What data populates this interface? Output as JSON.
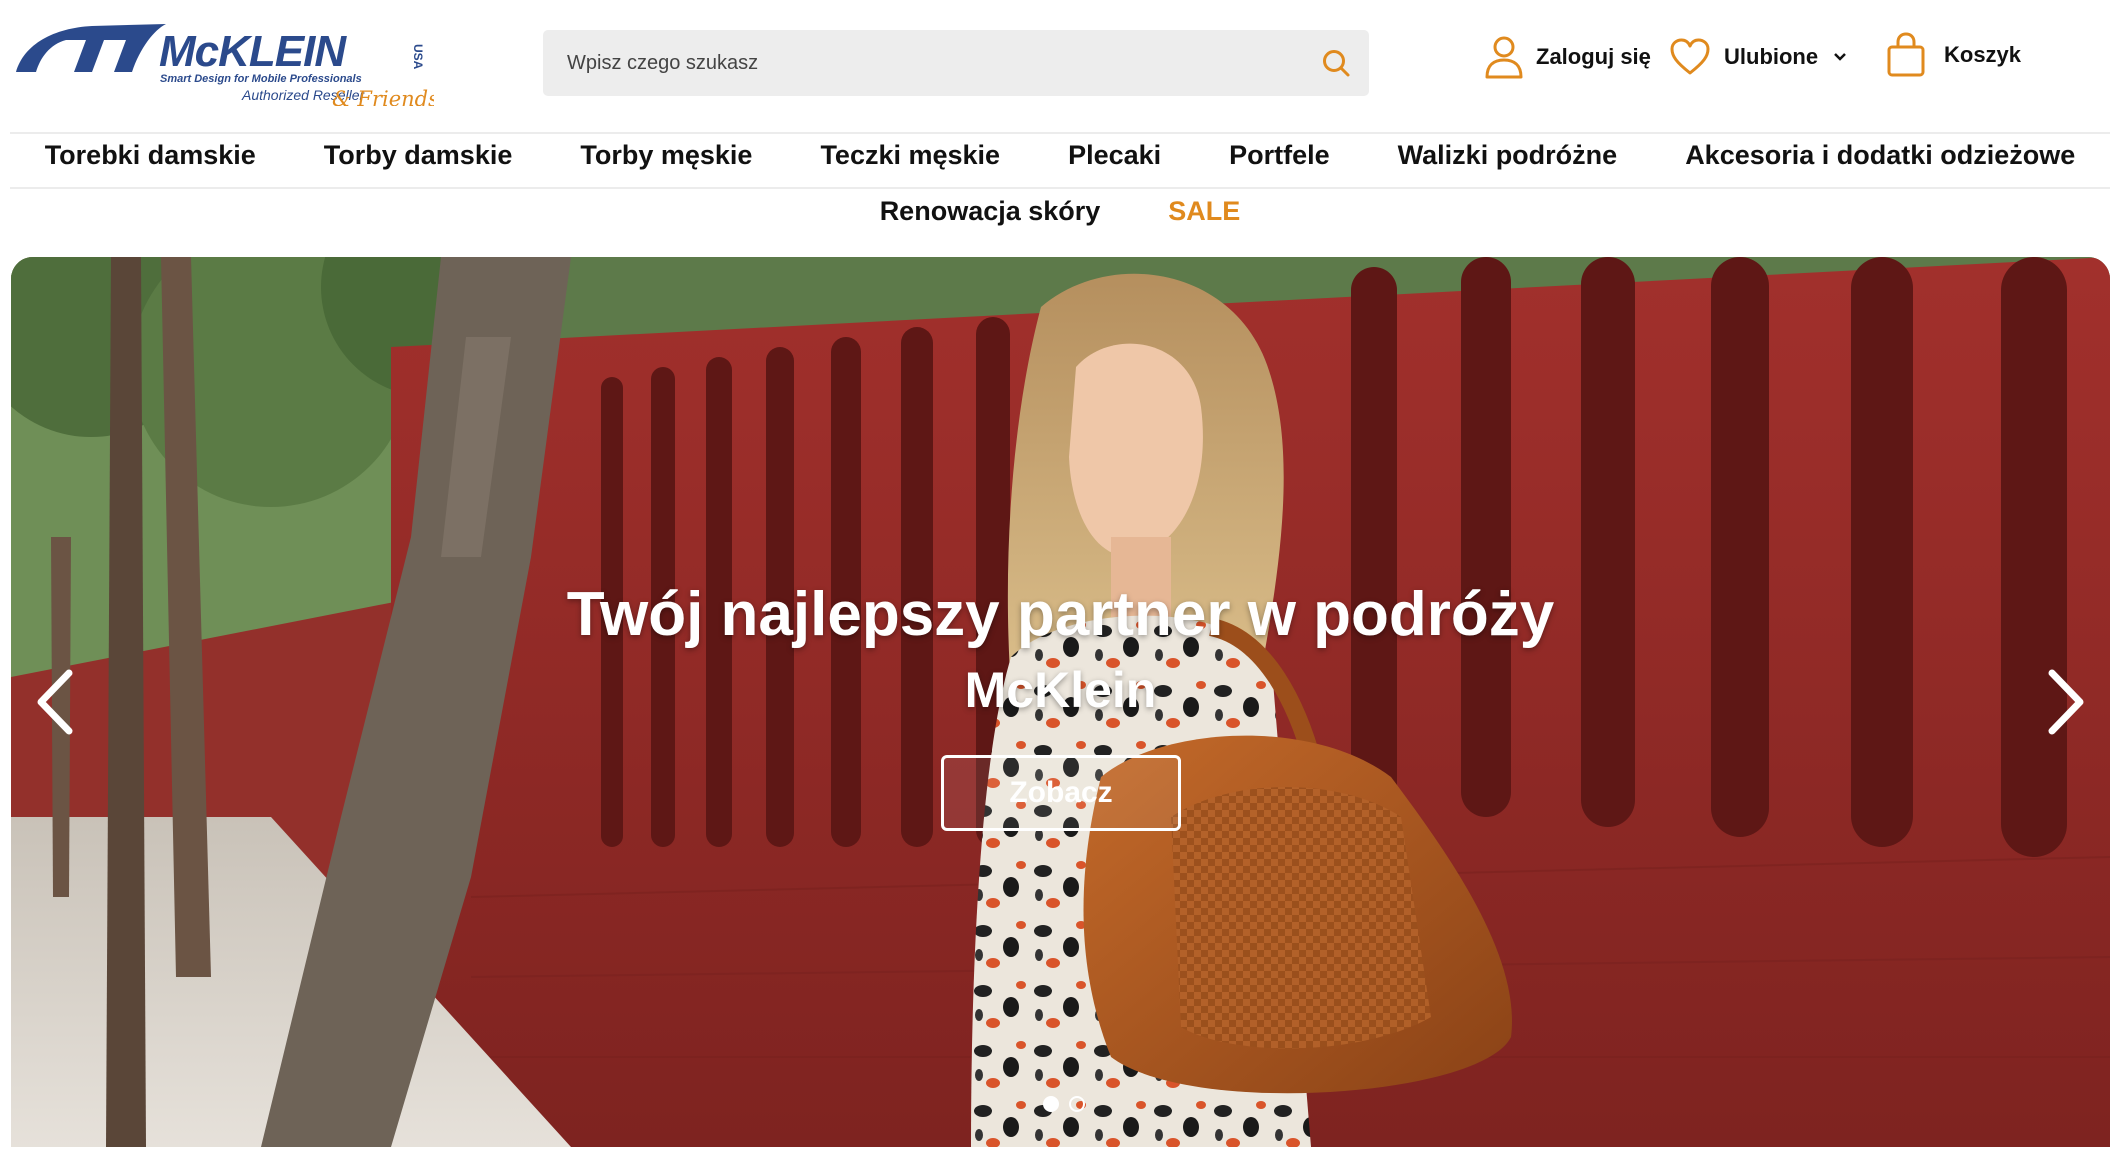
{
  "brand": {
    "logo_text": "McKLEIN",
    "logo_tagline": "Smart Design for Mobile Professionals",
    "logo_usa": "USA",
    "logo_reseller": "Authorized Reseller",
    "logo_friends": "& Friends",
    "colors": {
      "logo_blue": "#2b4a8c",
      "accent_orange": "#e08a1e"
    }
  },
  "search": {
    "placeholder": "Wpisz czego szukasz",
    "icon": "search-icon"
  },
  "header_actions": {
    "login_label": "Zaloguj się",
    "favorites_label": "Ulubione",
    "cart_label": "Koszyk"
  },
  "nav": {
    "row1": [
      {
        "label": "Torebki damskie"
      },
      {
        "label": "Torby damskie"
      },
      {
        "label": "Torby męskie"
      },
      {
        "label": "Teczki męskie"
      },
      {
        "label": "Plecaki"
      },
      {
        "label": "Portfele"
      },
      {
        "label": "Walizki podróżne"
      },
      {
        "label": "Akcesoria i dodatki odzieżowe"
      }
    ],
    "row2": [
      {
        "label": "Renowacja skóry"
      },
      {
        "label": "SALE"
      }
    ]
  },
  "hero": {
    "title": "Twój najlepszy partner w podróży",
    "subtitle": "McKlein",
    "button_label": "Zobacz",
    "slide_count": 2,
    "active_slide": 1
  }
}
